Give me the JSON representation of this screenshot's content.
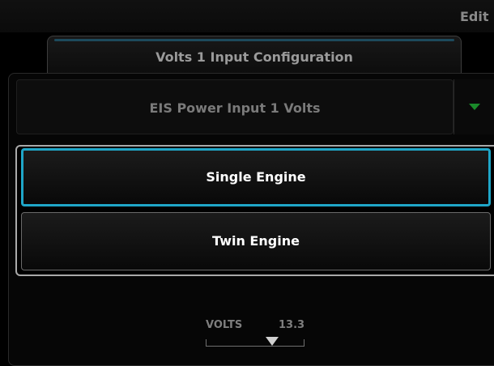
{
  "header": {
    "title": "Edit"
  },
  "tab": {
    "label": "Volts 1 Input Configuration"
  },
  "input_select": {
    "value": "EIS Power Input 1 Volts",
    "arrow_icon": "chevron-down-icon",
    "arrow_color": "#1a8a2a"
  },
  "engine_options": {
    "items": [
      {
        "label": "Single Engine",
        "selected": true
      },
      {
        "label": "Twin Engine",
        "selected": false
      }
    ],
    "selected_color": "#1fa6c8"
  },
  "readout": {
    "label": "VOLTS",
    "value": "13.3",
    "pointer_level": 0.67
  }
}
